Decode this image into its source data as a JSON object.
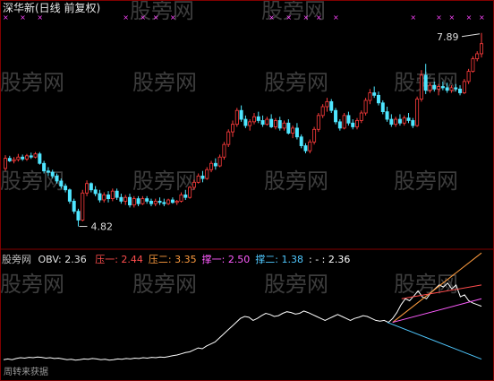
{
  "main_panel": {
    "title": "深华新(日线 前复权)",
    "high_label": "7.89",
    "low_label": "4.82"
  },
  "indicator_panel": {
    "name": "股旁网",
    "obv_label": "OBV: 2.36",
    "items": [
      {
        "label": "压一:",
        "value": "2.44",
        "color": "#ff4d4d"
      },
      {
        "label": "压二:",
        "value": "3.35",
        "color": "#ff9c3f"
      },
      {
        "label": "撑一:",
        "value": "2.50",
        "color": "#ff5cff"
      },
      {
        "label": "撑二:",
        "value": "1.38",
        "color": "#4fc8ff"
      },
      {
        "label": ": - :",
        "value": "2.36",
        "color": "#ffffff"
      }
    ]
  },
  "watermark": "股旁网",
  "footer_text": "周转来获据",
  "colors": {
    "up": "#ff3c3c",
    "down": "#4fe6ff",
    "markers": "#ff44ff",
    "obv": "#ffffff",
    "axis": "#800000"
  },
  "chart_data": [
    {
      "type": "candlestick",
      "title": "深华新(日线 前复权)",
      "annotations": [
        {
          "text": "7.89",
          "kind": "period-high"
        },
        {
          "text": "4.82",
          "kind": "period-low"
        }
      ],
      "ylim": [
        4.6,
        8.1
      ],
      "candles": [
        [
          5.74,
          5.95,
          5.7,
          5.9
        ],
        [
          5.9,
          5.94,
          5.84,
          5.86
        ],
        [
          5.86,
          5.92,
          5.82,
          5.88
        ],
        [
          5.88,
          5.97,
          5.85,
          5.92
        ],
        [
          5.92,
          5.96,
          5.86,
          5.89
        ],
        [
          5.89,
          5.97,
          5.86,
          5.94
        ],
        [
          5.94,
          5.99,
          5.89,
          5.92
        ],
        [
          5.92,
          6.0,
          5.9,
          5.97
        ],
        [
          5.97,
          6.0,
          5.8,
          5.82
        ],
        [
          5.82,
          5.86,
          5.66,
          5.7
        ],
        [
          5.7,
          5.76,
          5.62,
          5.68
        ],
        [
          5.68,
          5.72,
          5.58,
          5.62
        ],
        [
          5.62,
          5.66,
          5.5,
          5.54
        ],
        [
          5.54,
          5.58,
          5.42,
          5.46
        ],
        [
          5.46,
          5.5,
          5.36,
          5.4
        ],
        [
          5.4,
          5.42,
          5.18,
          5.22
        ],
        [
          5.22,
          5.26,
          5.02,
          5.06
        ],
        [
          5.06,
          5.1,
          4.82,
          4.92
        ],
        [
          4.92,
          5.4,
          4.9,
          5.35
        ],
        [
          5.35,
          5.55,
          5.3,
          5.5
        ],
        [
          5.5,
          5.52,
          5.36,
          5.4
        ],
        [
          5.4,
          5.46,
          5.3,
          5.34
        ],
        [
          5.34,
          5.4,
          5.2,
          5.24
        ],
        [
          5.24,
          5.36,
          5.2,
          5.32
        ],
        [
          5.32,
          5.38,
          5.2,
          5.26
        ],
        [
          5.26,
          5.42,
          5.22,
          5.38
        ],
        [
          5.38,
          5.42,
          5.24,
          5.28
        ],
        [
          5.28,
          5.34,
          5.18,
          5.22
        ],
        [
          5.22,
          5.32,
          5.16,
          5.28
        ],
        [
          5.28,
          5.34,
          5.12,
          5.16
        ],
        [
          5.16,
          5.3,
          5.12,
          5.26
        ],
        [
          5.26,
          5.3,
          5.14,
          5.18
        ],
        [
          5.18,
          5.3,
          5.16,
          5.26
        ],
        [
          5.26,
          5.3,
          5.18,
          5.22
        ],
        [
          5.22,
          5.26,
          5.14,
          5.18
        ],
        [
          5.18,
          5.26,
          5.14,
          5.22
        ],
        [
          5.22,
          5.28,
          5.16,
          5.2
        ],
        [
          5.2,
          5.26,
          5.14,
          5.18
        ],
        [
          5.18,
          5.26,
          5.16,
          5.24
        ],
        [
          5.24,
          5.28,
          5.18,
          5.2
        ],
        [
          5.2,
          5.24,
          5.16,
          5.22
        ],
        [
          5.22,
          5.36,
          5.2,
          5.32
        ],
        [
          5.32,
          5.4,
          5.24,
          5.28
        ],
        [
          5.28,
          5.46,
          5.26,
          5.44
        ],
        [
          5.44,
          5.56,
          5.4,
          5.52
        ],
        [
          5.52,
          5.66,
          5.5,
          5.62
        ],
        [
          5.62,
          5.7,
          5.52,
          5.58
        ],
        [
          5.58,
          5.76,
          5.56,
          5.72
        ],
        [
          5.72,
          5.86,
          5.68,
          5.82
        ],
        [
          5.82,
          5.9,
          5.72,
          5.78
        ],
        [
          5.78,
          5.96,
          5.76,
          5.92
        ],
        [
          5.92,
          6.16,
          5.88,
          6.12
        ],
        [
          6.12,
          6.36,
          6.08,
          6.32
        ],
        [
          6.32,
          6.5,
          6.24,
          6.44
        ],
        [
          6.44,
          6.7,
          6.4,
          6.66
        ],
        [
          6.66,
          6.74,
          6.48,
          6.52
        ],
        [
          6.52,
          6.58,
          6.38,
          6.42
        ],
        [
          6.42,
          6.52,
          6.34,
          6.48
        ],
        [
          6.48,
          6.62,
          6.44,
          6.56
        ],
        [
          6.56,
          6.64,
          6.46,
          6.5
        ],
        [
          6.5,
          6.58,
          6.4,
          6.44
        ],
        [
          6.44,
          6.56,
          6.42,
          6.52
        ],
        [
          6.52,
          6.6,
          6.38,
          6.4
        ],
        [
          6.4,
          6.54,
          6.36,
          6.5
        ],
        [
          6.5,
          6.56,
          6.34,
          6.38
        ],
        [
          6.38,
          6.5,
          6.34,
          6.46
        ],
        [
          6.46,
          6.52,
          6.28,
          6.3
        ],
        [
          6.3,
          6.42,
          6.22,
          6.38
        ],
        [
          6.38,
          6.46,
          6.2,
          6.24
        ],
        [
          6.24,
          6.28,
          6.06,
          6.1
        ],
        [
          6.1,
          6.14,
          5.98,
          6.02
        ],
        [
          6.02,
          6.2,
          5.98,
          6.16
        ],
        [
          6.16,
          6.4,
          6.12,
          6.36
        ],
        [
          6.36,
          6.62,
          6.32,
          6.58
        ],
        [
          6.58,
          6.76,
          6.54,
          6.72
        ],
        [
          6.72,
          6.86,
          6.64,
          6.8
        ],
        [
          6.8,
          6.84,
          6.62,
          6.66
        ],
        [
          6.66,
          6.7,
          6.44,
          6.48
        ],
        [
          6.48,
          6.52,
          6.34,
          6.38
        ],
        [
          6.38,
          6.62,
          6.36,
          6.58
        ],
        [
          6.58,
          6.64,
          6.42,
          6.46
        ],
        [
          6.46,
          6.52,
          6.36,
          6.4
        ],
        [
          6.4,
          6.54,
          6.36,
          6.5
        ],
        [
          6.5,
          6.66,
          6.46,
          6.62
        ],
        [
          6.62,
          6.86,
          6.58,
          6.82
        ],
        [
          6.82,
          7.0,
          6.76,
          6.94
        ],
        [
          6.94,
          7.04,
          6.86,
          6.9
        ],
        [
          6.9,
          6.96,
          6.74,
          6.78
        ],
        [
          6.78,
          6.82,
          6.6,
          6.64
        ],
        [
          6.64,
          6.72,
          6.48,
          6.52
        ],
        [
          6.52,
          6.6,
          6.4,
          6.44
        ],
        [
          6.44,
          6.56,
          6.4,
          6.52
        ],
        [
          6.52,
          6.6,
          6.42,
          6.46
        ],
        [
          6.46,
          6.58,
          6.42,
          6.54
        ],
        [
          6.54,
          6.62,
          6.46,
          6.5
        ],
        [
          6.5,
          6.54,
          6.38,
          6.42
        ],
        [
          6.42,
          6.88,
          6.4,
          6.84
        ],
        [
          6.84,
          7.3,
          6.8,
          7.22
        ],
        [
          7.22,
          7.4,
          6.92,
          6.98
        ],
        [
          6.98,
          7.1,
          6.94,
          7.06
        ],
        [
          7.06,
          7.12,
          6.96,
          7.0
        ],
        [
          7.0,
          7.08,
          6.9,
          7.04
        ],
        [
          7.04,
          7.12,
          6.98,
          7.02
        ],
        [
          7.02,
          7.1,
          6.94,
          6.98
        ],
        [
          6.98,
          7.06,
          6.94,
          7.02
        ],
        [
          7.02,
          7.08,
          6.96,
          7.0
        ],
        [
          7.0,
          7.06,
          6.9,
          6.94
        ],
        [
          6.94,
          7.16,
          6.92,
          7.12
        ],
        [
          7.12,
          7.32,
          7.08,
          7.28
        ],
        [
          7.28,
          7.52,
          7.26,
          7.48
        ],
        [
          7.48,
          7.6,
          7.44,
          7.56
        ],
        [
          7.56,
          7.89,
          7.5,
          7.72
        ]
      ]
    },
    {
      "type": "line",
      "title": "OBV",
      "series": [
        {
          "name": "OBV",
          "values": [
            1.0,
            1.02,
            1.0,
            1.03,
            1.05,
            1.04,
            1.06,
            1.05,
            1.07,
            1.06,
            1.04,
            1.05,
            1.03,
            1.04,
            1.02,
            1.0,
            1.01,
            0.99,
            1.0,
            1.02,
            1.01,
            1.03,
            1.02,
            1.0,
            1.01,
            0.99,
            1.0,
            1.02,
            1.01,
            1.03,
            1.02,
            1.04,
            1.03,
            1.05,
            1.04,
            1.06,
            1.05,
            1.07,
            1.06,
            1.08,
            1.1,
            1.12,
            1.15,
            1.18,
            1.2,
            1.25,
            1.3,
            1.28,
            1.35,
            1.4,
            1.45,
            1.55,
            1.65,
            1.75,
            1.85,
            1.95,
            2.05,
            2.1,
            2.08,
            2.0,
            2.05,
            2.12,
            2.18,
            2.15,
            2.1,
            2.12,
            2.18,
            2.22,
            2.2,
            2.16,
            2.18,
            2.24,
            2.2,
            2.15,
            2.1,
            2.05,
            2.0,
            2.05,
            2.1,
            2.15,
            2.1,
            2.05,
            2.0,
            2.05,
            2.08,
            2.12,
            2.1,
            2.05,
            2.0,
            1.98,
            2.0,
            1.95,
            2.05,
            2.2,
            2.4,
            2.55,
            2.5,
            2.62,
            2.75,
            2.6,
            2.55,
            2.7,
            2.8,
            2.9,
            2.85,
            2.95,
            2.8,
            2.9,
            2.6,
            2.65,
            2.5,
            2.44,
            2.4,
            2.36
          ]
        },
        {
          "name": "压一",
          "values": [
            2.44
          ]
        },
        {
          "name": "压二",
          "values": [
            3.35
          ]
        },
        {
          "name": "撑一",
          "values": [
            2.5
          ]
        },
        {
          "name": "撑二",
          "values": [
            1.38
          ]
        }
      ]
    }
  ]
}
